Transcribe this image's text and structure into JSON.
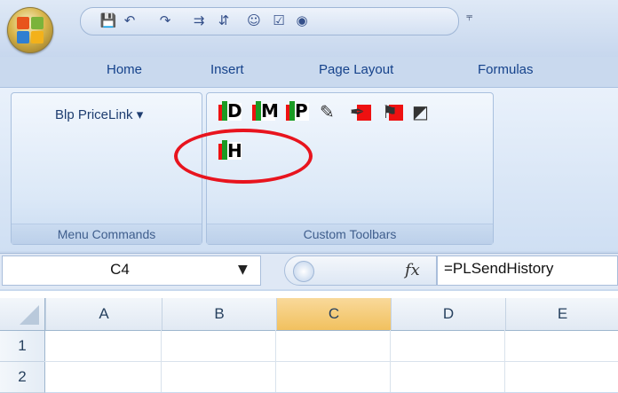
{
  "qat": {
    "icons": [
      "save-icon",
      "undo-icon",
      "redo-icon",
      "insert-row-icon",
      "format-icon",
      "user-icon",
      "checkbox-icon",
      "radio-icon"
    ]
  },
  "tabs": [
    "Home",
    "Insert",
    "Page Layout",
    "Formulas"
  ],
  "ribbon": {
    "groups": [
      {
        "label": "Menu Commands",
        "button_label": "Blp PriceLink",
        "arrow": "▾"
      },
      {
        "label": "Custom Toolbars"
      }
    ],
    "toolbar_buttons": [
      {
        "letter": "D"
      },
      {
        "letter": "M"
      },
      {
        "letter": "P"
      },
      {
        "icon": "pencil-icon"
      },
      {
        "icon": "brush-icon"
      },
      {
        "icon": "chart-icon"
      },
      {
        "icon": "graph-icon"
      },
      {
        "letter": "H"
      }
    ]
  },
  "formula_bar": {
    "name_box": "C4",
    "fx": "fx",
    "formula": "=PLSendHistory"
  },
  "grid": {
    "columns": [
      "A",
      "B",
      "C",
      "D",
      "E"
    ],
    "selected_column": "C",
    "rows": [
      "1",
      "2"
    ]
  },
  "colors": {
    "highlight": "#e8141e",
    "ribbon": "#dbe8f7",
    "selected_header": "#f1c15f"
  }
}
